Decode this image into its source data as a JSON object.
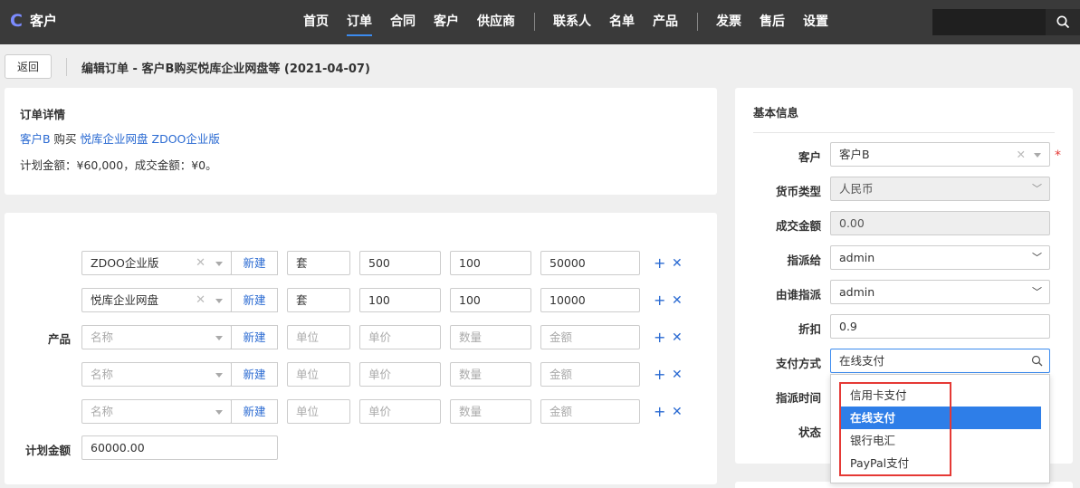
{
  "app": {
    "title": "客户"
  },
  "nav": {
    "items": [
      "首页",
      "订单",
      "合同",
      "客户",
      "供应商",
      "联系人",
      "名单",
      "产品",
      "发票",
      "售后",
      "设置"
    ],
    "active": "订单"
  },
  "header": {
    "back_label": "返回",
    "page_title": "编辑订单 - 客户B购买悦库企业网盘等 (2021-04-07)"
  },
  "detail": {
    "title": "订单详情",
    "customer_link": "客户B",
    "buy_word": " 购买 ",
    "product_link": "悦库企业网盘 ZDOO企业版",
    "amount_text": "计划金额：¥60,000，成交金额：¥0。"
  },
  "products": {
    "label": "产品",
    "new_label": "新建",
    "placeholders": {
      "name": "名称",
      "unit": "单位",
      "price": "单价",
      "qty": "数量",
      "amount": "金额"
    },
    "rows": [
      {
        "name": "ZDOO企业版",
        "unit": "套",
        "price": "500",
        "qty": "100",
        "amount": "50000"
      },
      {
        "name": "悦库企业网盘",
        "unit": "套",
        "price": "100",
        "qty": "100",
        "amount": "10000"
      },
      {
        "name": "",
        "unit": "",
        "price": "",
        "qty": "",
        "amount": ""
      },
      {
        "name": "",
        "unit": "",
        "price": "",
        "qty": "",
        "amount": ""
      },
      {
        "name": "",
        "unit": "",
        "price": "",
        "qty": "",
        "amount": ""
      }
    ],
    "plan_amount_label": "计划金额",
    "plan_amount_value": "60000.00"
  },
  "basic": {
    "title": "基本信息",
    "customer_label": "客户",
    "customer_value": "客户B",
    "currency_label": "货币类型",
    "currency_value": "人民币",
    "deal_amount_label": "成交金额",
    "deal_amount_value": "0.00",
    "assigned_to_label": "指派给",
    "assigned_to_value": "admin",
    "assigned_by_label": "由谁指派",
    "assigned_by_value": "admin",
    "discount_label": "折扣",
    "discount_value": "0.9",
    "payment_label": "支付方式",
    "payment_value": "在线支付",
    "assign_time_label": "指派时间",
    "status_label": "状态"
  },
  "payment_dropdown": {
    "options": [
      "信用卡支付",
      "在线支付",
      "银行电汇",
      "PayPal支付"
    ],
    "selected_index": 1
  },
  "colors": {
    "accent": "#2e7ee8",
    "link": "#2a6ad2",
    "highlight": "#e53935",
    "topbar": "#3a3a3a"
  }
}
